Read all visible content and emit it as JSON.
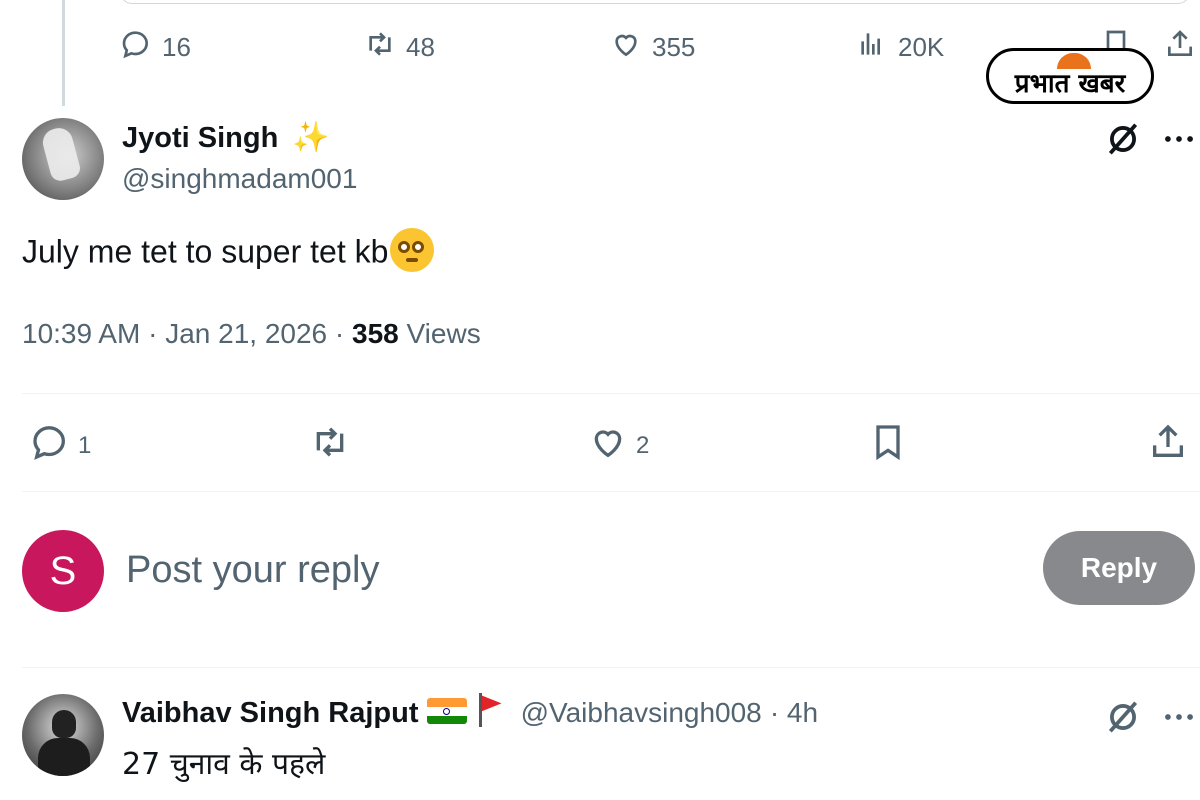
{
  "previous_post": {
    "actions": {
      "replies": "16",
      "reposts": "48",
      "likes": "355",
      "views": "20K"
    }
  },
  "watermark": {
    "text": "प्रभात खबर",
    "brand_color": "#e8731c"
  },
  "post": {
    "author_name": "Jyoti Singh",
    "author_badge": "sparkles-emoji",
    "author_handle": "@singhmadam001",
    "text": "July me tet to super tet kb",
    "text_emoji": "pleading-face-emoji",
    "time": "10:39 AM",
    "date": "Jan 21, 2026",
    "views_count": "358",
    "views_label": "Views",
    "separator": " · ",
    "actions": {
      "replies": "1",
      "likes": "2"
    }
  },
  "reply_composer": {
    "avatar_letter": "S",
    "avatar_color": "#c8175d",
    "placeholder": "Post your reply",
    "button_label": "Reply"
  },
  "reply": {
    "author_name": "Vaibhav Singh Rajput",
    "author_flags": [
      "india-flag-emoji",
      "red-flag-emoji"
    ],
    "author_handle": "@Vaibhavsingh008",
    "time": "· 4h",
    "text": "27 चुनाव के पहले"
  },
  "colors": {
    "text_primary": "#0f1419",
    "text_secondary": "#536471",
    "divider": "#eff3f4",
    "reply_button_disabled": "#87898c"
  }
}
